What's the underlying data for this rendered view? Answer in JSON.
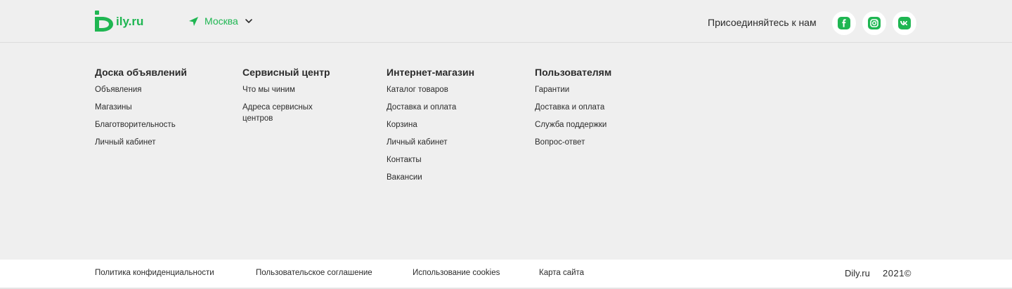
{
  "header": {
    "logo_text": "ily.ru",
    "city": "Москва",
    "join_label": "Присоединяйтесь к нам",
    "social": [
      {
        "icon": "facebook-icon",
        "glyph": "f"
      },
      {
        "icon": "instagram-icon",
        "glyph": ""
      },
      {
        "icon": "vk-icon",
        "glyph": "vk"
      }
    ]
  },
  "columns": [
    {
      "title": "Доска объявлений",
      "links": [
        "Объявления",
        "Магазины",
        "Благотворительность",
        "Личный кабинет"
      ]
    },
    {
      "title": "Сервисный центр",
      "links": [
        "Что мы чиним",
        "Адреса сервисных центров"
      ]
    },
    {
      "title": "Интернет-магазин",
      "links": [
        "Каталог товаров",
        "Доставка и оплата",
        "Корзина",
        "Личный кабинет",
        "Контакты",
        "Вакансии"
      ]
    },
    {
      "title": "Пользователям",
      "links": [
        "Гарантии",
        "Доставка и оплата",
        "Служба поддержки",
        "Вопрос-ответ"
      ]
    }
  ],
  "footer": {
    "links": [
      "Политика конфиденциальности",
      "Пользовательское соглашение",
      "Использование cookies",
      "Карта сайта"
    ],
    "brand": "Dily.ru",
    "year": "2021©"
  },
  "colors": {
    "accent": "#1fb652",
    "background": "#efefef",
    "text": "#2b2b2b"
  }
}
